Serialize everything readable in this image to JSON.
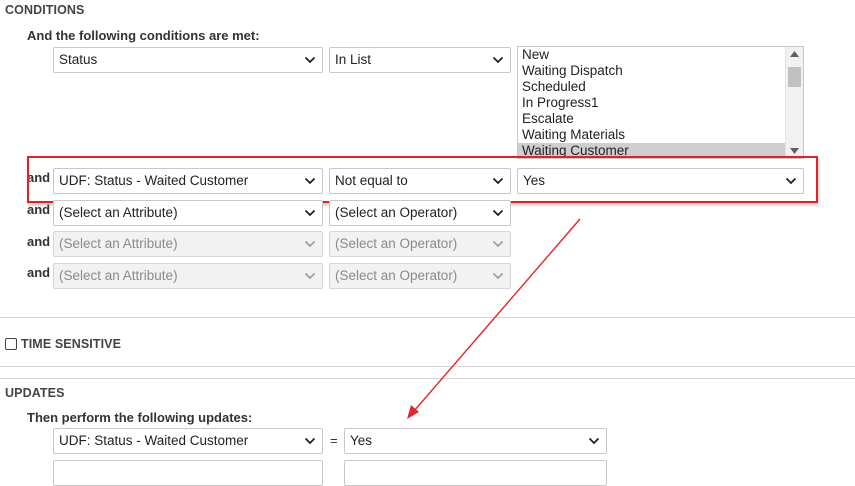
{
  "conditions": {
    "title": "CONDITIONS",
    "subhead": "And the following conditions are met:",
    "row1": {
      "attribute": "Status",
      "operator": "In List",
      "list_items": [
        "New",
        "Waiting Dispatch",
        "Scheduled",
        "In Progress1",
        "Escalate",
        "Waiting Materials",
        "Waiting Customer"
      ],
      "selected_item": "Waiting Customer"
    },
    "and_label": "and",
    "row2": {
      "attribute": "UDF: Status - Waited Customer",
      "operator": "Not equal to",
      "value": "Yes"
    },
    "row3": {
      "attribute": "(Select an Attribute)",
      "operator": "(Select an Operator)"
    },
    "row4": {
      "attribute": "(Select an Attribute)",
      "operator": "(Select an Operator)"
    },
    "row5": {
      "attribute": "(Select an Attribute)",
      "operator": "(Select an Operator)"
    }
  },
  "time_sensitive": {
    "label": "TIME SENSITIVE",
    "checked": false
  },
  "updates": {
    "title": "UPDATES",
    "subhead": "Then perform the following updates:",
    "row1": {
      "attribute": "UDF: Status - Waited Customer",
      "equals": "=",
      "value": "Yes"
    }
  },
  "colors": {
    "highlight_box": "#d9262c",
    "arrow": "#e0282e",
    "list_selected": "#cfcfcf"
  },
  "icons": {
    "dropdown": "chevron-down-icon"
  }
}
